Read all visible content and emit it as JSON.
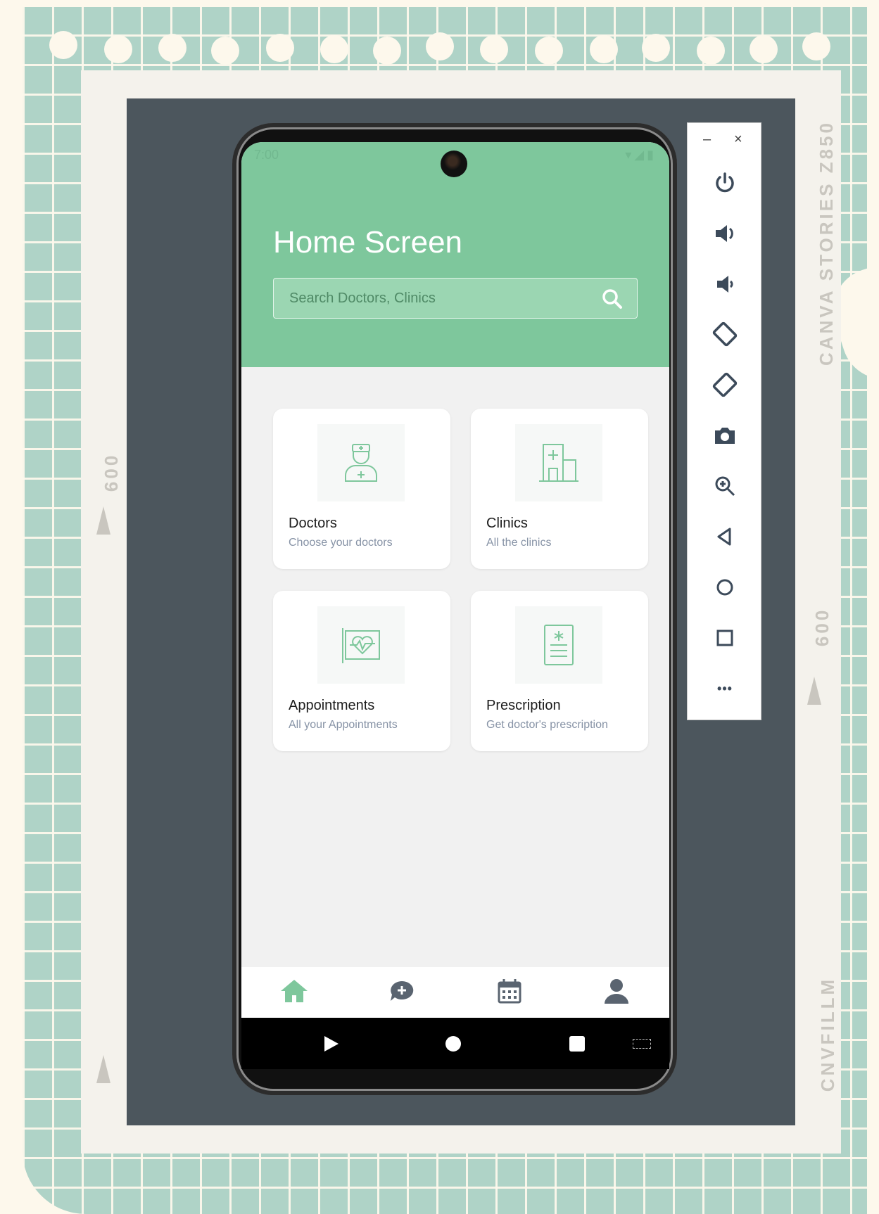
{
  "app": {
    "title": "Home Screen",
    "status_time": "7:00"
  },
  "search": {
    "placeholder": "Search Doctors, Clinics"
  },
  "cards": [
    {
      "title": "Doctors",
      "subtitle": "Choose your doctors",
      "icon": "doctor-icon"
    },
    {
      "title": "Clinics",
      "subtitle": "All the clinics",
      "icon": "hospital-icon"
    },
    {
      "title": "Appointments",
      "subtitle": "All your Appointments",
      "icon": "heart-monitor-icon"
    },
    {
      "title": "Prescription",
      "subtitle": "Get doctor's prescription",
      "icon": "prescription-icon"
    }
  ],
  "bottom_nav": [
    "home-icon",
    "chat-icon",
    "calendar-icon",
    "profile-icon"
  ],
  "system_nav": [
    "back-icon",
    "home-circle-icon",
    "recents-icon",
    "keyboard-icon"
  ],
  "emulator_toolbar": {
    "minimize": "–",
    "close": "×",
    "buttons": [
      "power-icon",
      "volume-up-icon",
      "volume-down-icon",
      "rotate-left-icon",
      "rotate-right-icon",
      "camera-icon",
      "zoom-icon",
      "back-icon",
      "home-icon",
      "overview-icon",
      "more-icon"
    ],
    "more_label": "•••"
  },
  "film_frame": {
    "label_right_top": "CANVA STORIES Z850",
    "label_right_bottom": "CNVFILLM",
    "label_left": "009",
    "label_right_mid": "009"
  },
  "colors": {
    "accent": "#7ec79c",
    "search_bg": "#9bd6b2",
    "icon": "#7ec79c",
    "backdrop": "#4c565d",
    "grid": "#afd3c7"
  }
}
